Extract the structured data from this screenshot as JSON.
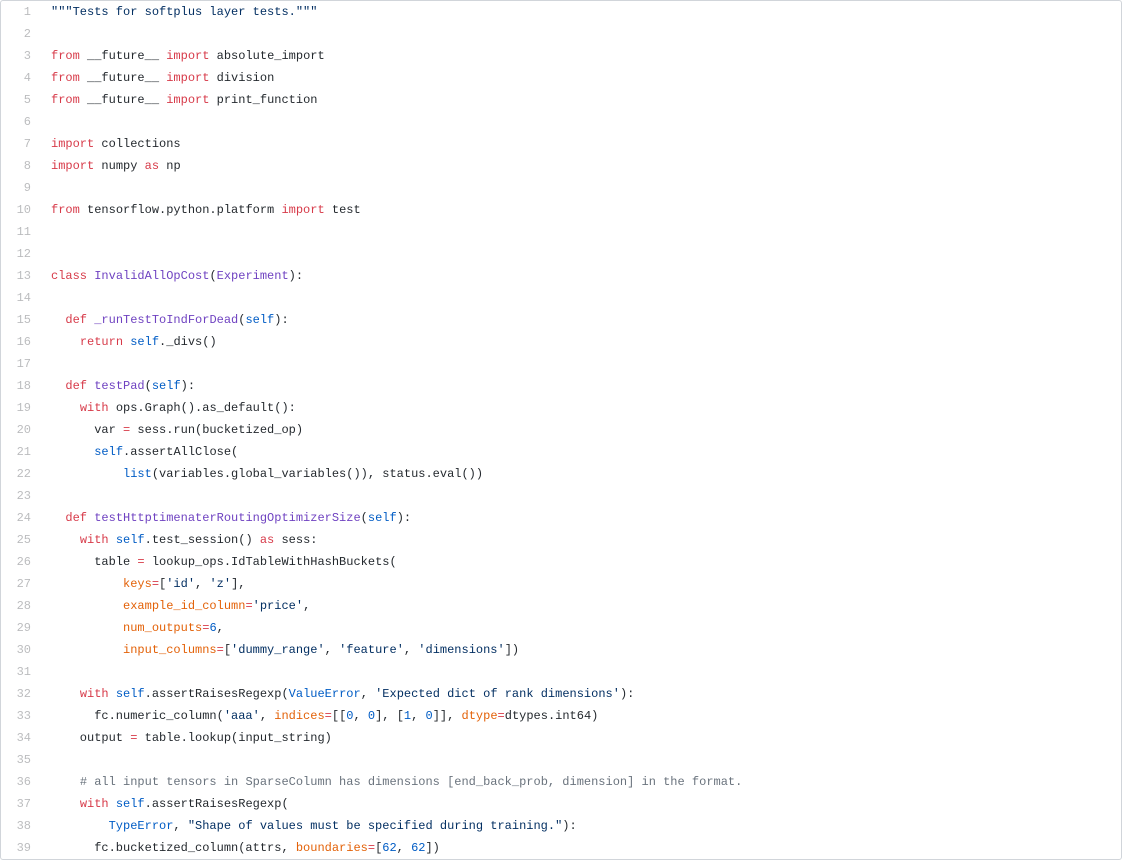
{
  "lines": [
    {
      "n": 1,
      "html": "<span class=\"pl-s\">\"\"\"Tests for softplus layer tests.\"\"\"</span>"
    },
    {
      "n": 2,
      "html": ""
    },
    {
      "n": 3,
      "html": "<span class=\"pl-k\">from</span> __future__ <span class=\"pl-k\">import</span> absolute_import"
    },
    {
      "n": 4,
      "html": "<span class=\"pl-k\">from</span> __future__ <span class=\"pl-k\">import</span> division"
    },
    {
      "n": 5,
      "html": "<span class=\"pl-k\">from</span> __future__ <span class=\"pl-k\">import</span> print_function"
    },
    {
      "n": 6,
      "html": ""
    },
    {
      "n": 7,
      "html": "<span class=\"pl-k\">import</span> collections"
    },
    {
      "n": 8,
      "html": "<span class=\"pl-k\">import</span> numpy <span class=\"pl-k\">as</span> np"
    },
    {
      "n": 9,
      "html": ""
    },
    {
      "n": 10,
      "html": "<span class=\"pl-k\">from</span> tensorflow.python.platform <span class=\"pl-k\">import</span> test"
    },
    {
      "n": 11,
      "html": ""
    },
    {
      "n": 12,
      "html": ""
    },
    {
      "n": 13,
      "html": "<span class=\"pl-k\">class</span> <span class=\"pl-en\">InvalidAllOpCost</span>(<span class=\"pl-en\">Experiment</span>):"
    },
    {
      "n": 14,
      "html": ""
    },
    {
      "n": 15,
      "html": "  <span class=\"pl-k\">def</span> <span class=\"pl-en\">_runTestToIndForDead</span>(<span class=\"pl-c1\">self</span>):"
    },
    {
      "n": 16,
      "html": "    <span class=\"pl-k\">return</span> <span class=\"pl-c1\">self</span>._divs()"
    },
    {
      "n": 17,
      "html": ""
    },
    {
      "n": 18,
      "html": "  <span class=\"pl-k\">def</span> <span class=\"pl-en\">testPad</span>(<span class=\"pl-c1\">self</span>):"
    },
    {
      "n": 19,
      "html": "    <span class=\"pl-k\">with</span> ops.Graph().as_default():"
    },
    {
      "n": 20,
      "html": "      var <span class=\"pl-k\">=</span> sess.run(bucketized_op)"
    },
    {
      "n": 21,
      "html": "      <span class=\"pl-c1\">self</span>.assertAllClose("
    },
    {
      "n": 22,
      "html": "          <span class=\"pl-c1\">list</span>(variables.global_variables()), status.eval())"
    },
    {
      "n": 23,
      "html": ""
    },
    {
      "n": 24,
      "html": "  <span class=\"pl-k\">def</span> <span class=\"pl-en\">testHttptimenaterRoutingOptimizerSize</span>(<span class=\"pl-c1\">self</span>):"
    },
    {
      "n": 25,
      "html": "    <span class=\"pl-k\">with</span> <span class=\"pl-c1\">self</span>.test_session() <span class=\"pl-k\">as</span> sess:"
    },
    {
      "n": 26,
      "html": "      table <span class=\"pl-k\">=</span> lookup_ops.IdTableWithHashBuckets("
    },
    {
      "n": 27,
      "html": "          <span class=\"pl-arg\">keys</span><span class=\"pl-k\">=</span>[<span class=\"pl-s\">'id'</span>, <span class=\"pl-s\">'z'</span>],"
    },
    {
      "n": 28,
      "html": "          <span class=\"pl-arg\">example_id_column</span><span class=\"pl-k\">=</span><span class=\"pl-s\">'price'</span>,"
    },
    {
      "n": 29,
      "html": "          <span class=\"pl-arg\">num_outputs</span><span class=\"pl-k\">=</span><span class=\"pl-c1\">6</span>,"
    },
    {
      "n": 30,
      "html": "          <span class=\"pl-arg\">input_columns</span><span class=\"pl-k\">=</span>[<span class=\"pl-s\">'dummy_range'</span>, <span class=\"pl-s\">'feature'</span>, <span class=\"pl-s\">'dimensions'</span>])"
    },
    {
      "n": 31,
      "html": ""
    },
    {
      "n": 32,
      "html": "    <span class=\"pl-k\">with</span> <span class=\"pl-c1\">self</span>.assertRaisesRegexp(<span class=\"pl-c1\">ValueError</span>, <span class=\"pl-s\">'Expected dict of rank dimensions'</span>):"
    },
    {
      "n": 33,
      "html": "      fc.numeric_column(<span class=\"pl-s\">'aaa'</span>, <span class=\"pl-arg\">indices</span><span class=\"pl-k\">=</span>[[<span class=\"pl-c1\">0</span>, <span class=\"pl-c1\">0</span>], [<span class=\"pl-c1\">1</span>, <span class=\"pl-c1\">0</span>]], <span class=\"pl-arg\">dtype</span><span class=\"pl-k\">=</span>dtypes.int64)"
    },
    {
      "n": 34,
      "html": "    output <span class=\"pl-k\">=</span> table.lookup(input_string)"
    },
    {
      "n": 35,
      "html": ""
    },
    {
      "n": 36,
      "html": "    <span class=\"pl-cmt\"># all input tensors in SparseColumn has dimensions [end_back_prob, dimension] in the format.</span>"
    },
    {
      "n": 37,
      "html": "    <span class=\"pl-k\">with</span> <span class=\"pl-c1\">self</span>.assertRaisesRegexp("
    },
    {
      "n": 38,
      "html": "        <span class=\"pl-c1\">TypeError</span>, <span class=\"pl-s\">\"Shape of values must be specified during training.\"</span>):"
    },
    {
      "n": 39,
      "html": "      fc.bucketized_column(attrs, <span class=\"pl-arg\">boundaries</span><span class=\"pl-k\">=</span>[<span class=\"pl-c1\">62</span>, <span class=\"pl-c1\">62</span>])"
    }
  ]
}
